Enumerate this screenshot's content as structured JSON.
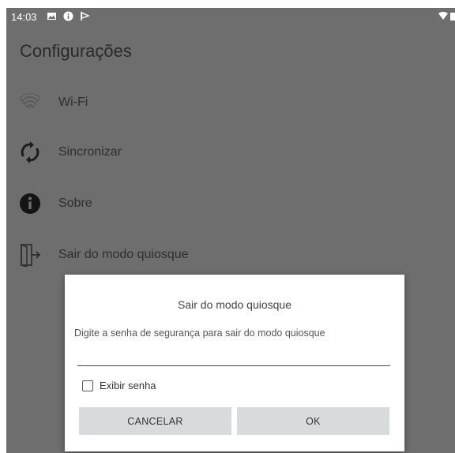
{
  "status_bar": {
    "time": "14:03",
    "icons": [
      "image-icon",
      "info-icon",
      "flag-icon"
    ],
    "right_icons": [
      "wifi-signal-icon",
      "battery-icon"
    ]
  },
  "page": {
    "title": "Configurações"
  },
  "menu": {
    "items": [
      {
        "label": "Wi-Fi",
        "icon": "wifi-icon"
      },
      {
        "label": "Sincronizar",
        "icon": "sync-icon"
      },
      {
        "label": "Sobre",
        "icon": "info-icon"
      },
      {
        "label": "Sair do modo quiosque",
        "icon": "exit-icon"
      }
    ]
  },
  "dialog": {
    "title": "Sair do modo quiosque",
    "message": "Digite a senha de segurança para sair do modo quiosque",
    "password_value": "",
    "password_placeholder": "",
    "show_password_label": "Exibir senha",
    "show_password_checked": false,
    "cancel_label": "CANCELAR",
    "ok_label": "OK"
  },
  "colors": {
    "scrim_background": "#6e6e6e",
    "dialog_background": "#ffffff",
    "button_background": "#d8dbdb"
  }
}
